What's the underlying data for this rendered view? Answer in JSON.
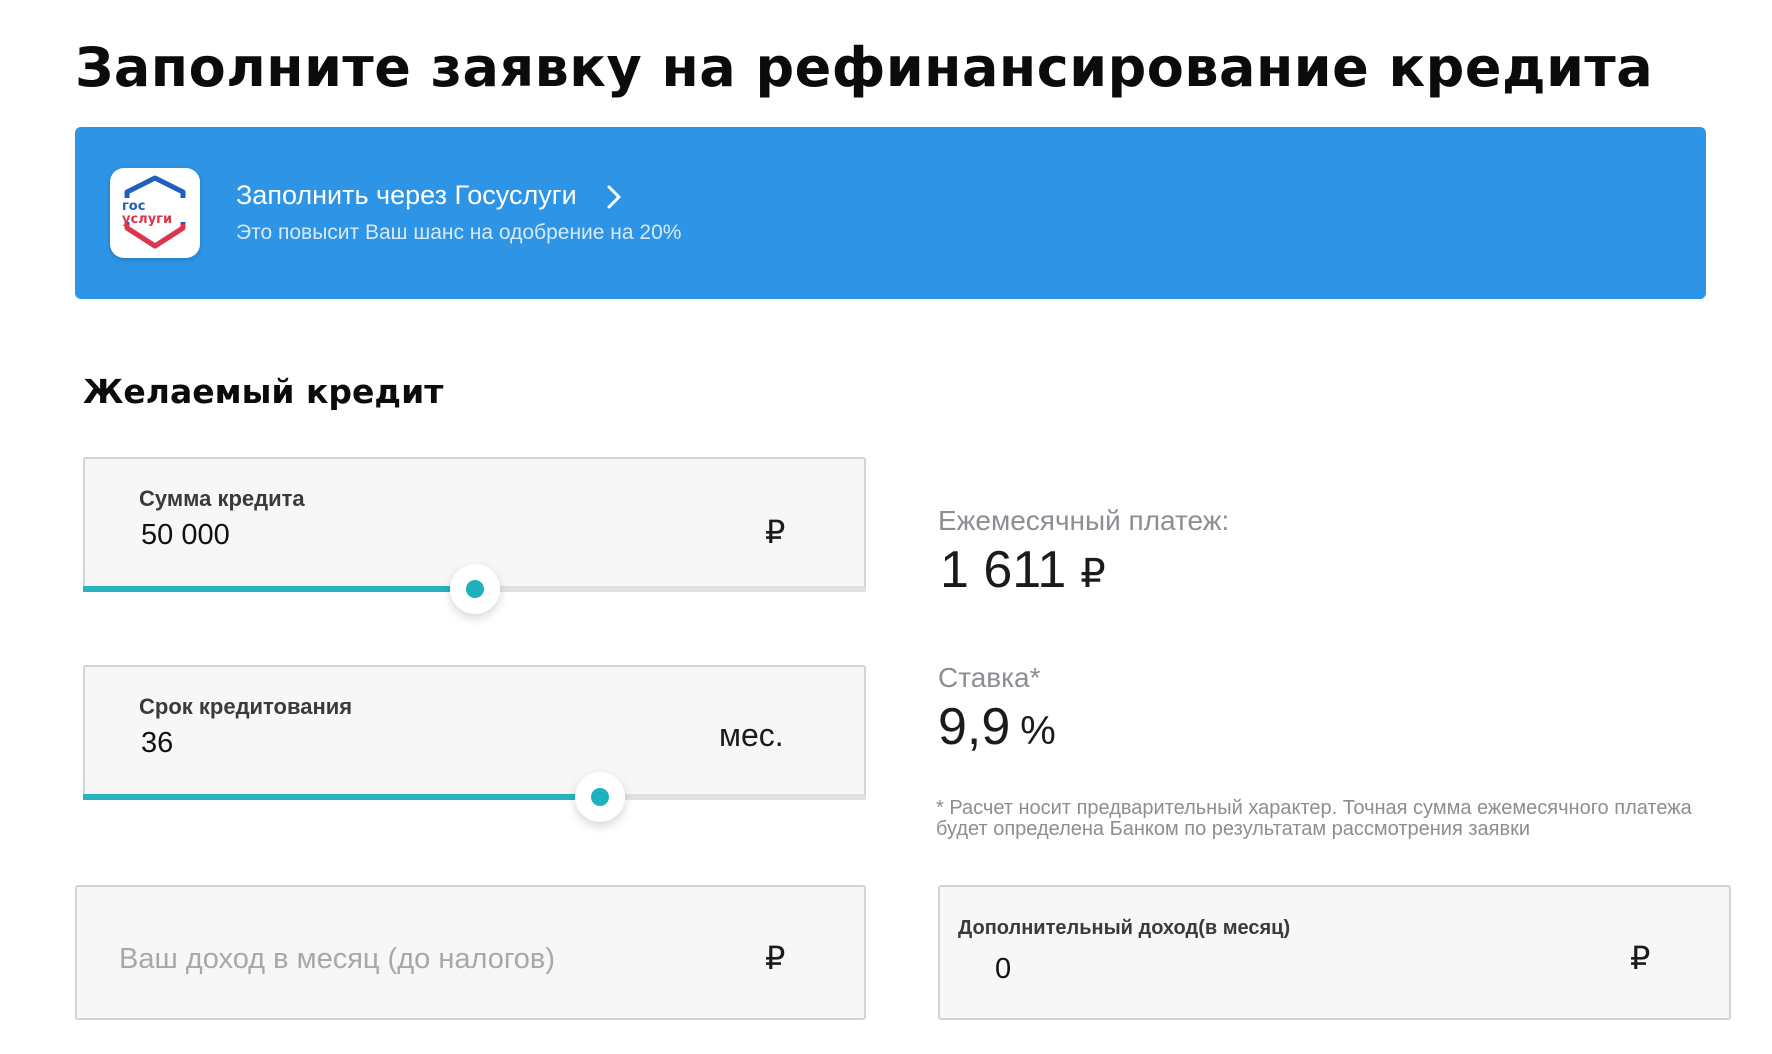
{
  "page": {
    "title": "Заполните заявку на рефинансирование кредита"
  },
  "gosuslugi_banner": {
    "logo_text_1": "гос",
    "logo_text_2": "услуги",
    "action_label": "Заполнить через Госуслуги",
    "subtitle": "Это повысит Ваш шанс на одобрение на 20%",
    "background_color": "#2e95e6"
  },
  "desired_credit": {
    "section_title": "Желаемый кредит",
    "amount": {
      "label": "Сумма кредита",
      "value": "50 000",
      "unit": "₽",
      "slider_fraction": 0.5
    },
    "term": {
      "label": "Срок кредитования",
      "value": "36",
      "unit": "мес.",
      "slider_fraction": 0.66
    },
    "income": {
      "placeholder": "Ваш доход в месяц (до налогов)",
      "unit": "₽"
    },
    "extra_income": {
      "label": "Дополнительный доход(в месяц)",
      "value": "0",
      "unit": "₽"
    }
  },
  "calculation": {
    "monthly_payment_label": "Ежемесячный платеж:",
    "monthly_payment_value": "1 611",
    "monthly_payment_unit": "₽",
    "rate_label": "Ставка*",
    "rate_value": "9,9",
    "rate_unit": "%",
    "disclaimer": "* Расчет носит предварительный характер. Точная сумма ежемесячного платежа будет определена Банком по результатам рассмотрения заявки"
  },
  "colors": {
    "accent_teal": "#26b3bd",
    "field_border": "#d3d4d6",
    "muted_text": "#8b8e93"
  }
}
